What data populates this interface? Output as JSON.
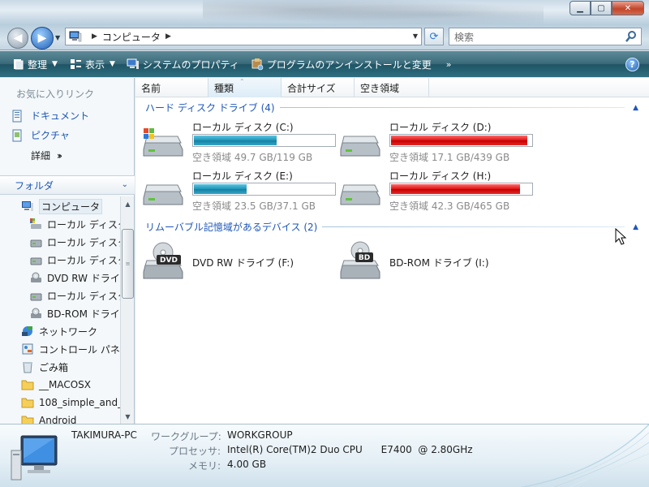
{
  "address": {
    "crumb": "コンピュータ"
  },
  "search": {
    "placeholder": "検索"
  },
  "toolbar": {
    "organize": "整理",
    "views": "表示",
    "system_properties": "システムのプロパティ",
    "uninstall": "プログラムのアンインストールと変更",
    "more": "»"
  },
  "favorites": {
    "title": "お気に入りリンク",
    "items": [
      {
        "label": "ドキュメント"
      },
      {
        "label": "ピクチャ"
      }
    ],
    "more": "詳細"
  },
  "folders": {
    "title": "フォルダ",
    "tree": [
      {
        "label": "コンピュータ",
        "icon": "computer-icon"
      },
      {
        "label": "ローカル ディスク",
        "icon": "windows-drive-icon"
      },
      {
        "label": "ローカル ディスク",
        "icon": "drive-icon"
      },
      {
        "label": "ローカル ディスク",
        "icon": "drive-icon"
      },
      {
        "label": "DVD RW ドライブ",
        "icon": "dvd-drive-icon"
      },
      {
        "label": "ローカル ディスク",
        "icon": "drive-icon"
      },
      {
        "label": "BD-ROM ドライブ",
        "icon": "bd-drive-icon"
      },
      {
        "label": "ネットワーク",
        "icon": "network-icon"
      },
      {
        "label": "コントロール パネル",
        "icon": "control-panel-icon"
      },
      {
        "label": "ごみ箱",
        "icon": "recycle-bin-icon"
      },
      {
        "label": "__MACOSX",
        "icon": "folder-icon"
      },
      {
        "label": "108_simple_and_",
        "icon": "folder-icon"
      },
      {
        "label": "Android",
        "icon": "folder-icon"
      }
    ]
  },
  "columns": [
    "名前",
    "種類",
    "合計サイズ",
    "空き領域"
  ],
  "groups": {
    "hdd": "ハード ディスク ドライブ (4)",
    "removable": "リムーバブル記憶域があるデバイス (2)"
  },
  "drives": [
    {
      "name": "ローカル ディスク (C:)",
      "free": "空き領域 49.7 GB/119 GB",
      "used_fraction": 0.58,
      "status": "ok",
      "system": true
    },
    {
      "name": "ローカル ディスク (D:)",
      "free": "空き領域 17.1 GB/439 GB",
      "used_fraction": 0.96,
      "status": "low",
      "system": false
    },
    {
      "name": "ローカル ディスク (E:)",
      "free": "空き領域 23.5 GB/37.1 GB",
      "used_fraction": 0.37,
      "status": "ok",
      "system": false
    },
    {
      "name": "ローカル ディスク (H:)",
      "free": "空き領域 42.3 GB/465 GB",
      "used_fraction": 0.91,
      "status": "low",
      "system": false
    }
  ],
  "removable": [
    {
      "name": "DVD RW ドライブ (F:)",
      "badge": "DVD"
    },
    {
      "name": "BD-ROM ドライブ (I:)",
      "badge": "BD"
    }
  ],
  "details": {
    "computer_name": "TAKIMURA-PC",
    "workgroup_label": "ワークグループ:",
    "workgroup_value": "WORKGROUP",
    "processor_label": "プロセッサ:",
    "processor_value": "Intel(R) Core(TM)2 Duo CPU      E7400  @ 2.80GHz",
    "memory_label": "メモリ:",
    "memory_value": "4.00 GB"
  },
  "colors": {
    "accent": "#1e57b8",
    "bar_ok": "#1e93b6",
    "bar_low": "#dd1111",
    "toolbar": "#2f6f80"
  }
}
